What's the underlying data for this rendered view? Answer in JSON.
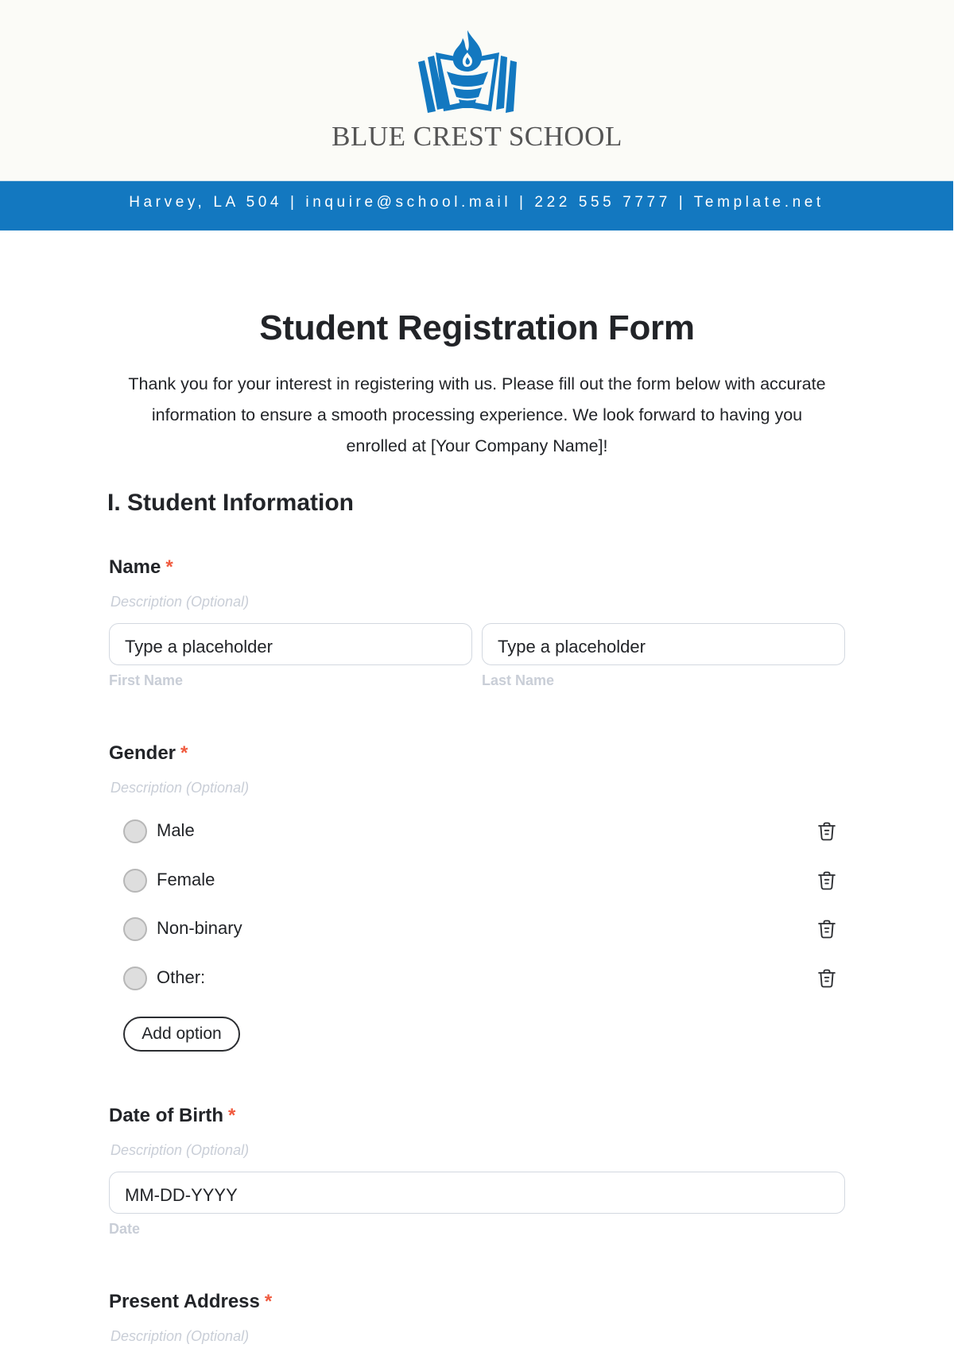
{
  "header": {
    "logo_icon": "book-torch-logo-icon",
    "school_name": "BLUE CREST SCHOOL",
    "brand_color": "#1378c0",
    "contact_line": "Harvey, LA 504 | inquire@school.mail | 222 555 7777 | Template.net"
  },
  "form": {
    "title": "Student Registration Form",
    "intro": "Thank you for your interest in registering with us. Please fill out the form below with accurate information to ensure a smooth processing experience. We look forward to having you enrolled at [Your Company Name]!",
    "required_marker": "*",
    "required_color": "#f05a3e",
    "section_heading": "I. Student Information",
    "fields": {
      "name": {
        "label": "Name",
        "description": "Description (Optional)",
        "first": {
          "placeholder": "Type a placeholder",
          "sublabel": "First Name"
        },
        "last": {
          "placeholder": "Type a placeholder",
          "sublabel": "Last Name"
        }
      },
      "gender": {
        "label": "Gender",
        "description": "Description (Optional)",
        "options": [
          {
            "label": "Male",
            "delete_icon": "trash-icon"
          },
          {
            "label": "Female",
            "delete_icon": "trash-icon"
          },
          {
            "label": "Non-binary",
            "delete_icon": "trash-icon"
          },
          {
            "label": "Other:",
            "delete_icon": "trash-icon"
          }
        ],
        "add_option_label": "Add option"
      },
      "dob": {
        "label": "Date of Birth",
        "description": "Description (Optional)",
        "placeholder": "MM-DD-YYYY",
        "sublabel": "Date"
      },
      "address": {
        "label": "Present Address",
        "description": "Description (Optional)"
      }
    }
  }
}
